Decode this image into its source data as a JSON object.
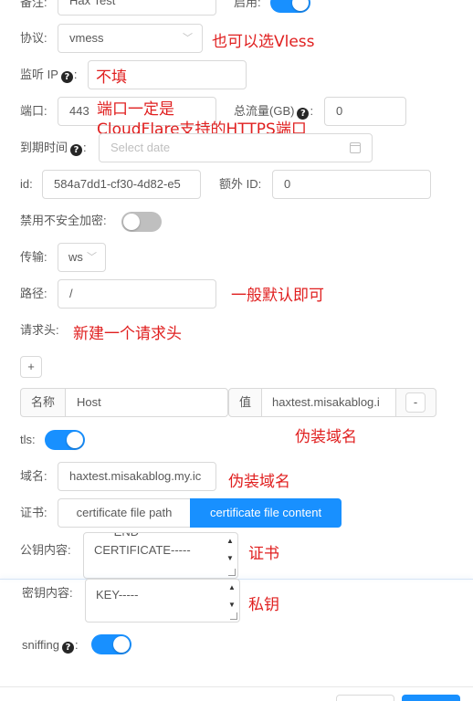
{
  "form": {
    "remark": {
      "label": "备注:",
      "value": "Hax Test"
    },
    "enable": {
      "label": "启用:",
      "on": true
    },
    "protocol": {
      "label": "协议:",
      "value": "vmess"
    },
    "listen_ip": {
      "label": "监听 IP",
      "value": ""
    },
    "port": {
      "label": "端口:",
      "value": "443"
    },
    "total_traffic": {
      "label": "总流量(GB)",
      "value": "0"
    },
    "expiry": {
      "label": "到期时间",
      "placeholder": "Select date"
    },
    "id": {
      "label": "id:",
      "value": "584a7dd1-cf30-4d82-e5"
    },
    "alter_id": {
      "label": "额外 ID:",
      "value": "0"
    },
    "disable_insecure": {
      "label": "禁用不安全加密:",
      "on": false
    },
    "transport": {
      "label": "传输:",
      "value": "ws"
    },
    "path": {
      "label": "路径:",
      "value": "/"
    },
    "request_header": {
      "label": "请求头:",
      "add_label": "+"
    },
    "header_row": {
      "name_label": "名称",
      "name_value": "Host",
      "value_label": "值",
      "value_value": "haxtest.misakablog.i",
      "remove_label": "-"
    },
    "tls": {
      "label": "tls:",
      "on": true
    },
    "domain": {
      "label": "域名:",
      "value": "haxtest.misakablog.my.ic"
    },
    "certificate": {
      "label": "证书:",
      "option_path": "certificate file path",
      "option_content": "certificate file content",
      "selected": "certificate file content"
    },
    "public_key": {
      "label": "公钥内容:",
      "line1": "-----END",
      "line2": "CERTIFICATE-----"
    },
    "private_key": {
      "label": "密钥内容:",
      "line1": "KEY-----"
    },
    "sniffing": {
      "label": "sniffing",
      "on": true
    }
  },
  "annotations": {
    "protocol_note": "也可以选Vless",
    "listen_note": "不填",
    "port_note_1": "端口一定是",
    "port_note_2": "CloudFlare支持的HTTPS端口",
    "path_note": "一般默认即可",
    "header_note": "新建一个请求头",
    "host_note": "伪装域名",
    "domain_note": "伪装域名",
    "cert_note": "证书",
    "key_note": "私钥"
  },
  "colors": {
    "primary": "#1890ff",
    "annotation": "#e02020",
    "border": "#d9d9d9",
    "text": "#595959"
  }
}
